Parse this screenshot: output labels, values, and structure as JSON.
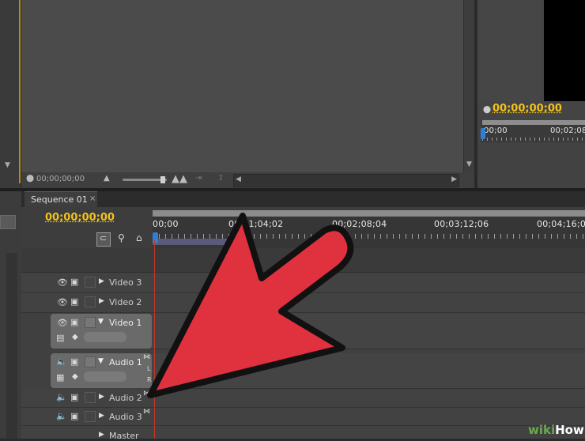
{
  "source_monitor": {
    "timecode": "00;00;00;00"
  },
  "program_monitor": {
    "timecode": "00;00;00;00",
    "ruler_labels": [
      "00;00",
      "00;02;08"
    ]
  },
  "sequence_panel": {
    "tab_label": "Sequence 01",
    "tab_close": "×",
    "timecode": "00;00;00;00",
    "ruler_labels": [
      "00;00",
      "00;01;04;02",
      "00;02;08;04",
      "00;03;12;06",
      "00;04;16;0"
    ],
    "tracks": [
      {
        "name": "Video 3",
        "kind": "video",
        "expanded": false
      },
      {
        "name": "Video 2",
        "kind": "video",
        "expanded": false
      },
      {
        "name": "Video 1",
        "kind": "video",
        "expanded": true
      },
      {
        "name": "Audio 1",
        "kind": "audio",
        "expanded": true
      },
      {
        "name": "Audio 2",
        "kind": "audio",
        "expanded": false
      },
      {
        "name": "Audio 3",
        "kind": "audio",
        "expanded": false
      },
      {
        "name": "Master",
        "kind": "audio",
        "expanded": false
      }
    ]
  },
  "audio_lr": {
    "l": "L",
    "r": "R"
  },
  "watermark": {
    "wiki": "wiki",
    "how": "How"
  },
  "colors": {
    "accent_timecode": "#f2c21b",
    "arrow_fill": "#e0313f",
    "playhead": "#c0392b",
    "watermark_green": "#6aa84f"
  }
}
